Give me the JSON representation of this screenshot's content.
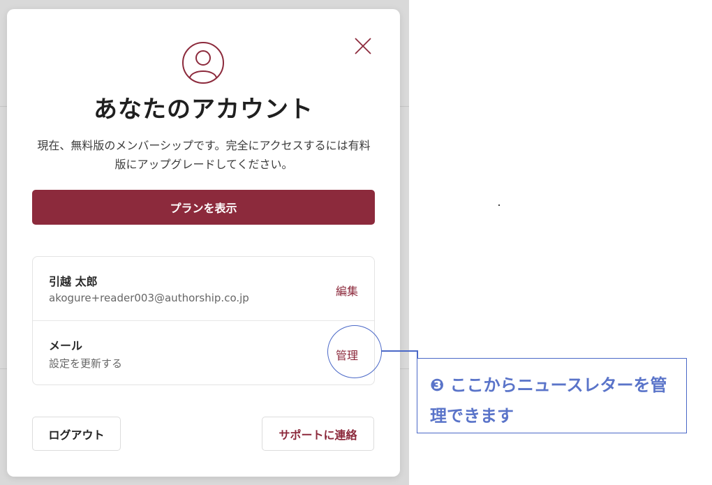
{
  "modal": {
    "title": "あなたのアカウント",
    "description": "現在、無料版のメンバーシップです。完全にアクセスするには有料版にアップグレードしてください。",
    "plan_button": "プランを表示",
    "close_icon": "close-icon",
    "avatar_icon": "user-circle-icon"
  },
  "account": {
    "name": "引越 太郎",
    "email": "akogure+reader003@authorship.co.jp",
    "edit_label": "編集"
  },
  "mail": {
    "title": "メール",
    "subtitle": "設定を更新する",
    "manage_label": "管理"
  },
  "footer": {
    "logout_label": "ログアウト",
    "support_label": "サポートに連絡"
  },
  "annotation": {
    "text": "❸ ここからニュースレターを管理できます"
  },
  "colors": {
    "accent": "#8c2a3c",
    "annotation": "#4a68c7"
  }
}
